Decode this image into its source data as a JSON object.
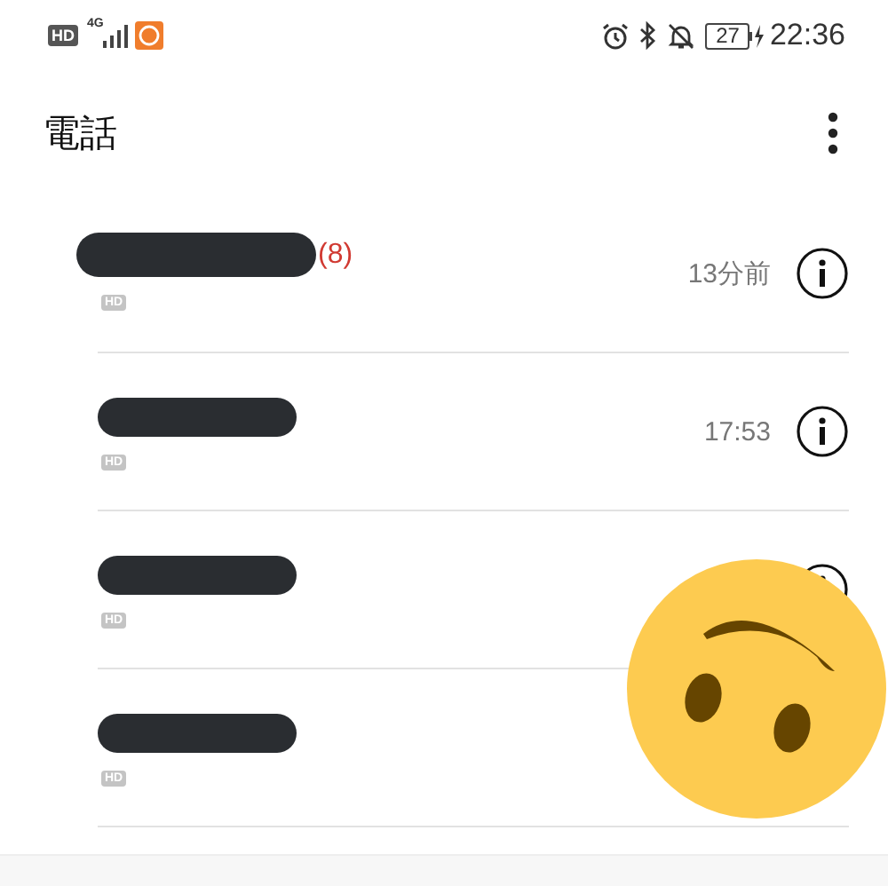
{
  "status_bar": {
    "hd": "HD",
    "network": "4G",
    "battery": "27",
    "time": "22:36"
  },
  "header": {
    "title": "電話"
  },
  "calls": [
    {
      "count": "(8)",
      "hd": "HD",
      "time": "13分前",
      "info": true
    },
    {
      "hd": "HD",
      "time": "17:53",
      "info": true
    },
    {
      "hd": "HD",
      "info": true
    },
    {
      "hd": "HD",
      "info": false
    }
  ]
}
